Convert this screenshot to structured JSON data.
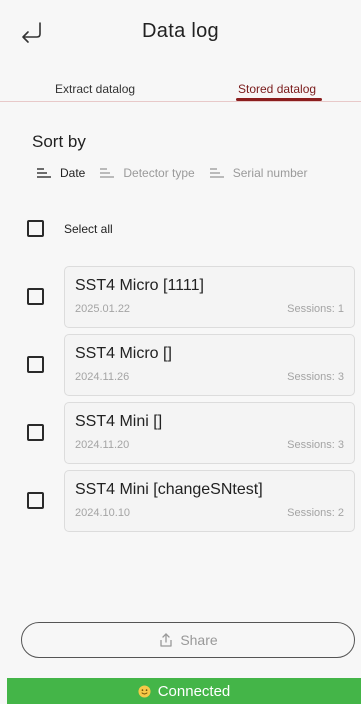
{
  "header": {
    "title": "Data log"
  },
  "tabs": [
    {
      "label": "Extract datalog",
      "active": false
    },
    {
      "label": "Stored datalog",
      "active": true
    }
  ],
  "sort": {
    "title": "Sort by",
    "options": [
      {
        "label": "Date",
        "active": true
      },
      {
        "label": "Detector type",
        "active": false
      },
      {
        "label": "Serial number",
        "active": false
      }
    ]
  },
  "select_all_label": "Select all",
  "items": [
    {
      "name": "SST4 Micro [1111]",
      "date": "2025.01.22",
      "sessions": "Sessions: 1",
      "checked": false
    },
    {
      "name": "SST4 Micro []",
      "date": "2024.11.26",
      "sessions": "Sessions: 3",
      "checked": false
    },
    {
      "name": "SST4 Mini []",
      "date": "2024.11.20",
      "sessions": "Sessions: 3",
      "checked": false
    },
    {
      "name": "SST4 Mini [changeSNtest]",
      "date": "2024.10.10",
      "sessions": "Sessions: 2",
      "checked": false
    }
  ],
  "share_label": "Share",
  "status": {
    "label": "Connected",
    "color": "#44b548"
  },
  "icons": {
    "back": "back-arrow-icon",
    "sort": "sort-lines-icon",
    "share": "share-upload-icon",
    "status": "smiley-face-icon"
  },
  "accent_color": "#8b1e1e"
}
